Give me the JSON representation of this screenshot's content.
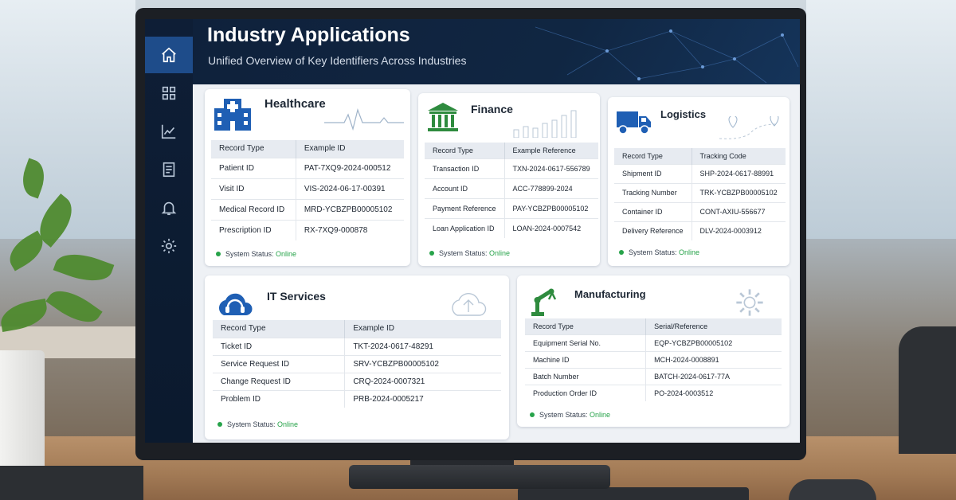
{
  "header": {
    "title": "Industry Applications",
    "subtitle": "Unified Overview of Key Identifiers Across Industries"
  },
  "sidebar": {
    "items": [
      {
        "icon": "home-icon",
        "active": true
      },
      {
        "icon": "grid-icon",
        "active": false
      },
      {
        "icon": "chart-icon",
        "active": false
      },
      {
        "icon": "document-icon",
        "active": false
      },
      {
        "icon": "bell-icon",
        "active": false
      },
      {
        "icon": "gear-icon",
        "active": false
      }
    ]
  },
  "status": {
    "label": "System Status:",
    "value": "Online",
    "color": "#27a34a"
  },
  "cards": {
    "healthcare": {
      "title": "Healthcare",
      "icon": "hospital-icon",
      "headers": [
        "Record Type",
        "Example ID"
      ],
      "rows": [
        [
          "Patient ID",
          "PAT-7XQ9-2024-000512"
        ],
        [
          "Visit ID",
          "VIS-2024-06-17-00391"
        ],
        [
          "Medical Record ID",
          "MRD-YCBZPB00005102"
        ],
        [
          "Prescription ID",
          "RX-7XQ9-000878"
        ]
      ]
    },
    "finance": {
      "title": "Finance",
      "icon": "bank-icon",
      "headers": [
        "Record Type",
        "Example Reference"
      ],
      "rows": [
        [
          "Transaction ID",
          "TXN-2024-0617-556789"
        ],
        [
          "Account ID",
          "ACC-778899-2024"
        ],
        [
          "Payment Reference",
          "PAY-YCBZPB00005102"
        ],
        [
          "Loan Application ID",
          "LOAN-2024-0007542"
        ]
      ]
    },
    "logistics": {
      "title": "Logistics",
      "icon": "truck-icon",
      "headers": [
        "Record Type",
        "Tracking Code"
      ],
      "rows": [
        [
          "Shipment ID",
          "SHP-2024-0617-88991"
        ],
        [
          "Tracking Number",
          "TRK-YCBZPB00005102"
        ],
        [
          "Container ID",
          "CONT-AXIU-556677"
        ],
        [
          "Delivery Reference",
          "DLV-2024-0003912"
        ]
      ]
    },
    "it_services": {
      "title": "IT Services",
      "icon": "cloud-headset-icon",
      "headers": [
        "Record Type",
        "Example ID"
      ],
      "rows": [
        [
          "Ticket ID",
          "TKT-2024-0617-48291"
        ],
        [
          "Service Request ID",
          "SRV-YCBZPB00005102"
        ],
        [
          "Change Request ID",
          "CRQ-2024-0007321"
        ],
        [
          "Problem ID",
          "PRB-2024-0005217"
        ]
      ]
    },
    "manufacturing": {
      "title": "Manufacturing",
      "icon": "robot-arm-icon",
      "headers": [
        "Record Type",
        "Serial/Reference"
      ],
      "rows": [
        [
          "Equipment Serial No.",
          "EQP-YCBZPB00005102"
        ],
        [
          "Machine ID",
          "MCH-2024-0008891"
        ],
        [
          "Batch Number",
          "BATCH-2024-0617-77A"
        ],
        [
          "Production Order ID",
          "PO-2024-0003512"
        ]
      ]
    }
  }
}
